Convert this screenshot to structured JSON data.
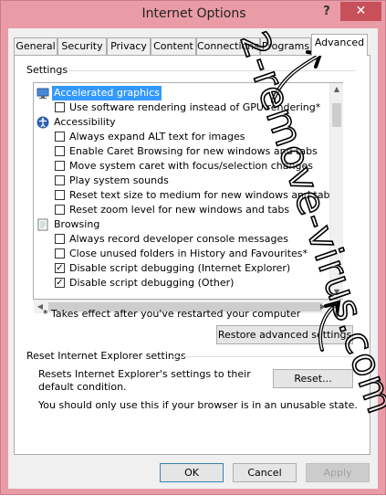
{
  "window": {
    "title": "Internet Options",
    "help_glyph": "?",
    "close_glyph": "✕"
  },
  "tabs": [
    {
      "label": "General"
    },
    {
      "label": "Security"
    },
    {
      "label": "Privacy"
    },
    {
      "label": "Content"
    },
    {
      "label": "Connections"
    },
    {
      "label": "Programs"
    },
    {
      "label": "Advanced",
      "active": true
    }
  ],
  "settings": {
    "group_label": "Settings",
    "items": [
      {
        "type": "category",
        "label": "Accelerated graphics",
        "icon": "monitor-icon",
        "selected": true
      },
      {
        "type": "checkbox",
        "label": "Use software rendering instead of GPU rendering*",
        "checked": false
      },
      {
        "type": "category",
        "label": "Accessibility",
        "icon": "accessibility-icon"
      },
      {
        "type": "checkbox",
        "label": "Always expand ALT text for images",
        "checked": false
      },
      {
        "type": "checkbox",
        "label": "Enable Caret Browsing for new windows and tabs",
        "checked": false
      },
      {
        "type": "checkbox",
        "label": "Move system caret with focus/selection changes",
        "checked": false
      },
      {
        "type": "checkbox",
        "label": "Play system sounds",
        "checked": false
      },
      {
        "type": "checkbox",
        "label": "Reset text size to medium for new windows and tabs",
        "checked": false
      },
      {
        "type": "checkbox",
        "label": "Reset zoom level for new windows and tabs",
        "checked": false
      },
      {
        "type": "category",
        "label": "Browsing",
        "icon": "page-icon"
      },
      {
        "type": "checkbox",
        "label": "Always record developer console messages",
        "checked": false
      },
      {
        "type": "checkbox",
        "label": "Close unused folders in History and Favourites*",
        "checked": false
      },
      {
        "type": "checkbox",
        "label": "Disable script debugging (Internet Explorer)",
        "checked": true
      },
      {
        "type": "checkbox",
        "label": "Disable script debugging (Other)",
        "checked": true
      }
    ],
    "restart_note": "* Takes effect after you've restarted your computer",
    "restore_button": "Restore advanced settings"
  },
  "reset": {
    "group_label": "Reset Internet Explorer settings",
    "description": "Resets Internet Explorer's settings to their default condition.",
    "reset_button": "Reset...",
    "warning": "You should only use this if your browser is in an unusable state."
  },
  "footer": {
    "ok": "OK",
    "cancel": "Cancel",
    "apply": "Apply"
  },
  "watermark": {
    "text": "2-remove-virus.com"
  },
  "colors": {
    "frame": "#e99ba6",
    "close": "#c7505a",
    "selection": "#3399ff"
  }
}
